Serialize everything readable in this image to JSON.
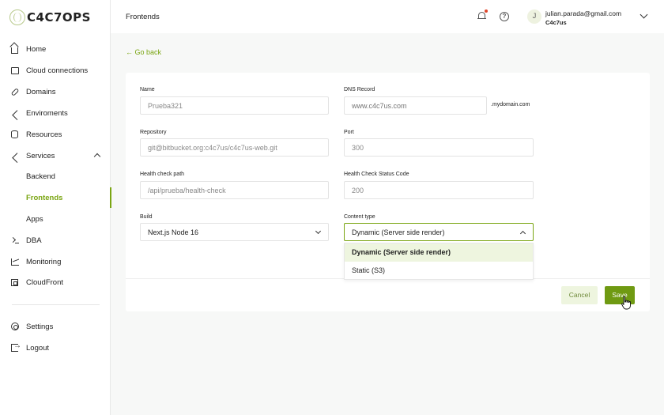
{
  "app": {
    "logo_text": "C4C7OPS"
  },
  "header": {
    "title": "Frontends",
    "avatar_initial": "J",
    "user_email": "julian.parada@gmail.com",
    "user_org": "C4c7us"
  },
  "sidebar": {
    "items": [
      {
        "label": "Home",
        "icon": "home-icon"
      },
      {
        "label": "Cloud connections",
        "icon": "cloud-icon"
      },
      {
        "label": "Domains",
        "icon": "link-icon"
      },
      {
        "label": "Enviroments",
        "icon": "share-icon"
      },
      {
        "label": "Resources",
        "icon": "database-icon"
      },
      {
        "label": "Services",
        "icon": "share-icon"
      },
      {
        "label": "Backend"
      },
      {
        "label": "Frontends"
      },
      {
        "label": "Apps"
      },
      {
        "label": "DBA",
        "icon": "terminal-icon"
      },
      {
        "label": "Monitoring",
        "icon": "chart-icon"
      },
      {
        "label": "CloudFront",
        "icon": "grid-icon"
      }
    ],
    "bottom": [
      {
        "label": "Settings",
        "icon": "gear-icon"
      },
      {
        "label": "Logout",
        "icon": "logout-icon"
      }
    ]
  },
  "back_link": "Go back",
  "form": {
    "name": {
      "label": "Name",
      "value": "Prueba321"
    },
    "dns": {
      "label": "DNS Record",
      "placeholder": "www.c4c7us.com",
      "suffix": ".mydomain.com"
    },
    "repository": {
      "label": "Repository",
      "value": "git@bitbucket.org:c4c7us/c4c7us-web.git"
    },
    "port": {
      "label": "Port",
      "value": "300"
    },
    "health_path": {
      "label": "Health check path",
      "value": "/api/prueba/health-check"
    },
    "health_status": {
      "label": "Health Check Status Code",
      "value": "200"
    },
    "build": {
      "label": "Build",
      "value": "Next.js Node 16"
    },
    "content_type": {
      "label": "Content type",
      "value": "Dynamic (Server side render)",
      "options": [
        "Dynamic (Server side render)",
        "Static (S3)"
      ]
    },
    "cancel_label": "Cancel",
    "save_label": "Save"
  },
  "colors": {
    "accent": "#7aa512",
    "save_bg": "#6f9a12",
    "selected_bg": "#eef5df",
    "notification_dot": "#e0462a"
  }
}
